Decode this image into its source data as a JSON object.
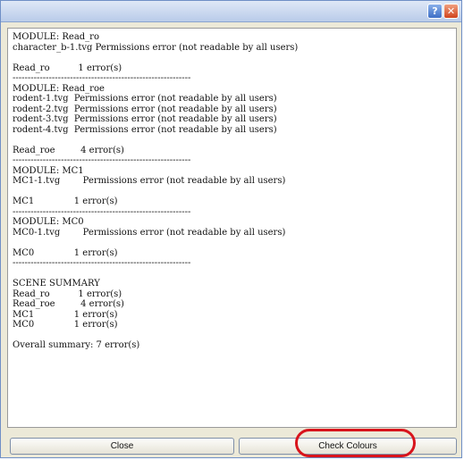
{
  "titlebar": {
    "help_label": "?",
    "close_label": "✕"
  },
  "log": [
    "MODULE: Read_ro",
    "character_b-1.tvg Permissions error (not readable by all users)",
    "",
    "Read_ro          1 error(s)",
    "-----------------------------------------------------------",
    "MODULE: Read_roe",
    "rodent-1.tvg  Permissions error (not readable by all users)",
    "rodent-2.tvg  Permissions error (not readable by all users)",
    "rodent-3.tvg  Permissions error (not readable by all users)",
    "rodent-4.tvg  Permissions error (not readable by all users)",
    "",
    "Read_roe         4 error(s)",
    "-----------------------------------------------------------",
    "MODULE: MC1",
    "MC1-1.tvg        Permissions error (not readable by all users)",
    "",
    "MC1              1 error(s)",
    "-----------------------------------------------------------",
    "MODULE: MC0",
    "MC0-1.tvg        Permissions error (not readable by all users)",
    "",
    "MC0              1 error(s)",
    "-----------------------------------------------------------",
    "",
    "SCENE SUMMARY",
    "Read_ro          1 error(s)",
    "Read_roe         4 error(s)",
    "MC1              1 error(s)",
    "MC0              1 error(s)",
    "",
    "Overall summary: 7 error(s)"
  ],
  "footer": {
    "close_label": "Close",
    "check_colours_label": "Check Colours"
  },
  "colors": {
    "highlight": "#d8141c"
  }
}
